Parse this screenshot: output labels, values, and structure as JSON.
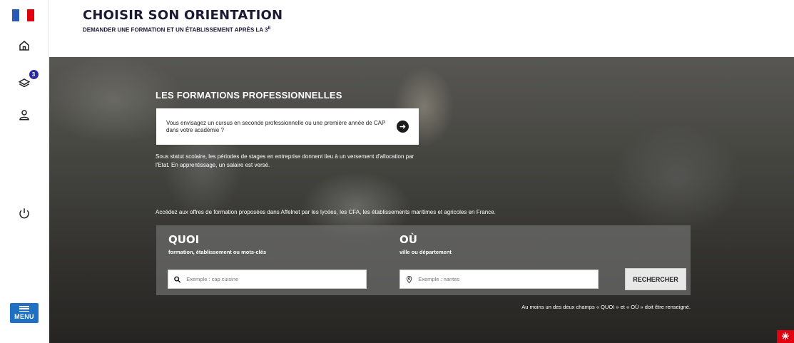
{
  "colors": {
    "flag_blue": "#2a5ab8",
    "flag_white": "#ffffff",
    "flag_red": "#e1000f",
    "accent_blue": "#1f6fc3",
    "badge": "#2b2c9a"
  },
  "sidebar": {
    "icons": [
      "home-icon",
      "layers-icon",
      "user-icon",
      "power-icon"
    ],
    "badge_count": "3",
    "menu_label": "MENU"
  },
  "header": {
    "title": "CHOISIR SON ORIENTATION",
    "subtitle": "DEMANDER UNE FORMATION ET UN ÉTABLISSEMENT APRÈS LA 3",
    "subtitle_sup": "E"
  },
  "hero": {
    "section_title": "LES FORMATIONS PROFESSIONNELLES",
    "promo_text": "Vous envisagez un cursus en seconde professionnelle ou une première année de CAP dans votre académie ?",
    "info_text": "Sous statut scolaire, les périodes de stages en entreprise donnent lieu à un versement d'allocation par l'Etat. En apprentissage, un salaire est versé.",
    "access_text": "Accédez aux offres de formation proposées dans Affelnet par les lycées, les CFA, les établissements maritimes et agricoles en France."
  },
  "search": {
    "what_title": "QUOI",
    "what_sub": "formation, établissement ou mots-clés",
    "what_placeholder": "Exemple : cap cuisine",
    "where_title": "OÙ",
    "where_sub": "ville ou département",
    "where_placeholder": "Exemple : nantes",
    "button_label": "RECHERCHER",
    "notice": "Au moins un des deux champs « QUOI » et « OÙ » doit être renseigné."
  }
}
